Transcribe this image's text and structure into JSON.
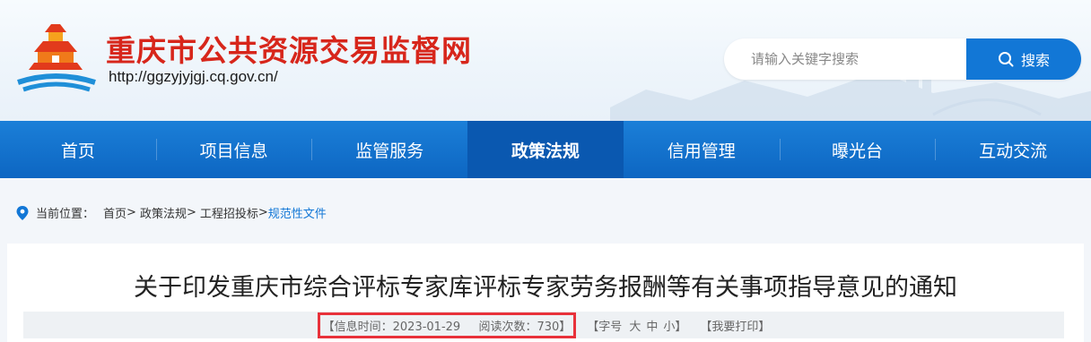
{
  "header": {
    "site_title": "重庆市公共资源交易监督网",
    "site_url": "http://ggzyjyjgj.cq.gov.cn/",
    "logo_icon": "city-gate-logo-icon"
  },
  "search": {
    "placeholder": "请输入关键字搜索",
    "button_label": "搜索",
    "icon": "search-icon"
  },
  "nav": {
    "items": [
      {
        "label": "首页"
      },
      {
        "label": "项目信息"
      },
      {
        "label": "监管服务"
      },
      {
        "label": "政策法规",
        "active": true
      },
      {
        "label": "信用管理"
      },
      {
        "label": "曝光台"
      },
      {
        "label": "互动交流"
      }
    ]
  },
  "breadcrumb": {
    "prefix": "当前位置：",
    "items": [
      "首页",
      "政策法规",
      "工程招投标",
      "规范性文件"
    ],
    "separator": ">"
  },
  "article": {
    "title": "关于印发重庆市综合评标专家库评标专家劳务报酬等有关事项指导意见的通知",
    "info_time_label": "【信息时间：2023-01-29",
    "read_count_label": "阅读次数：730】",
    "font_size_label": "【字号",
    "font_large": "大",
    "font_medium": "中",
    "font_small": "小】",
    "print_label": "【我要打印】"
  },
  "colors": {
    "brand_blue": "#1277d6",
    "title_red": "#d7261b",
    "highlight_red": "#e8313a"
  }
}
